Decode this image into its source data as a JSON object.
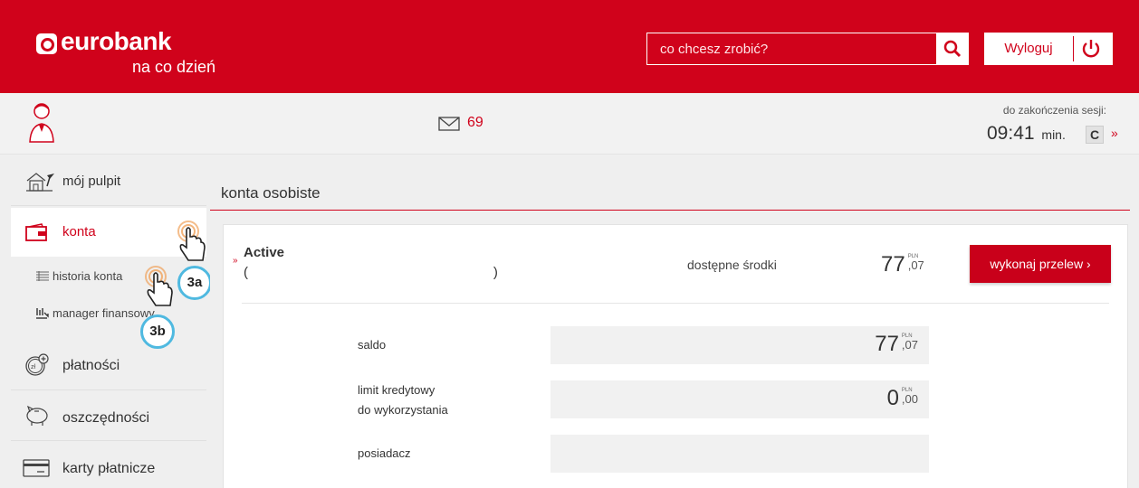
{
  "header": {
    "logo_name": "eurobank",
    "logo_tagline": "na co dzień",
    "search_placeholder": "co chcesz zrobić?",
    "logout_label": "Wyloguj"
  },
  "colors": {
    "brand": "#d0021b",
    "badge_ring": "#4fb9e0"
  },
  "statusbar": {
    "message_count": "69",
    "session_label": "do zakończenia sesji:",
    "session_time": "09:41",
    "session_unit": "min.",
    "refresh_label": "C",
    "more_label": "»"
  },
  "sidebar": {
    "items": [
      {
        "label": "mój pulpit",
        "icon": "house-icon"
      },
      {
        "label": "konta",
        "icon": "wallet-icon"
      },
      {
        "label": "płatności",
        "icon": "coin-icon"
      },
      {
        "label": "oszczędności",
        "icon": "piggy-bank-icon"
      },
      {
        "label": "karty płatnicze",
        "icon": "card-icon"
      }
    ],
    "subitems": [
      {
        "label": "historia konta",
        "icon": "list-icon"
      },
      {
        "label": "manager finansowy",
        "icon": "chart-icon"
      }
    ],
    "annotations": [
      "3a",
      "3b"
    ]
  },
  "main": {
    "title": "konta osobiste",
    "account": {
      "name": "Active",
      "number": "(                                                                 )",
      "available_label": "dostępne środki",
      "available_int": "77",
      "available_dec": ",07",
      "currency": "PLN",
      "transfer_label": "wykonaj przelew ›"
    },
    "details": [
      {
        "label": "saldo",
        "int": "77",
        "dec": ",07",
        "currency": "PLN"
      },
      {
        "label": "limit kredytowy",
        "label2": "do wykorzystania",
        "int": "0",
        "dec": ",00",
        "currency": "PLN"
      },
      {
        "label": "posiadacz"
      }
    ]
  }
}
